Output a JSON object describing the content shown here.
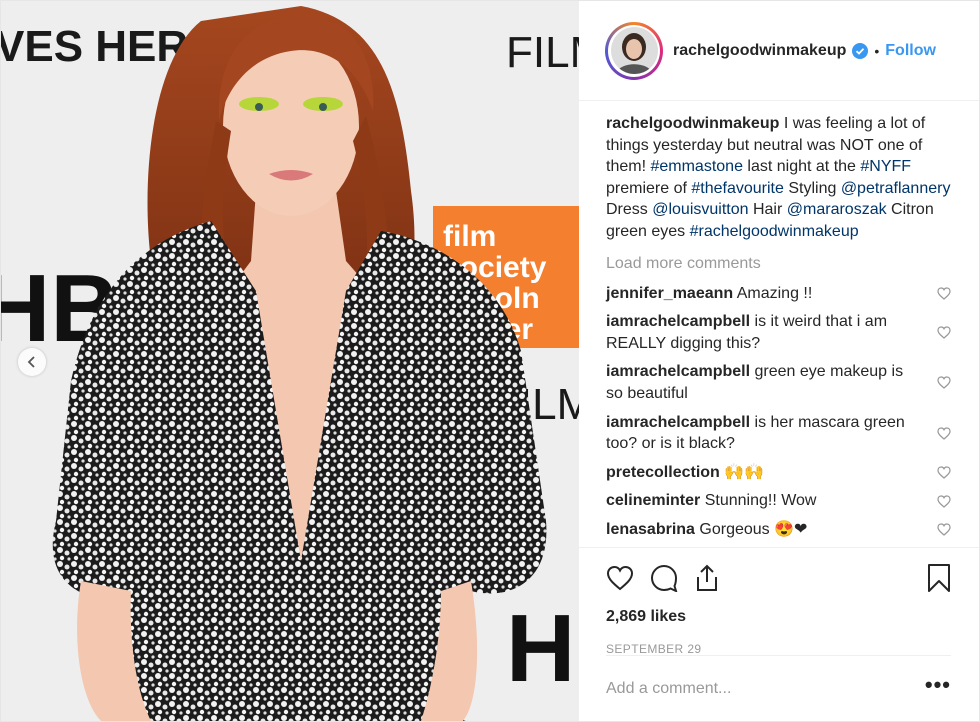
{
  "photo": {
    "alt_backdrop_text": [
      "VES HERE",
      "FILM",
      "film",
      "society",
      "lincoln",
      "center",
      "FILM",
      "HBO",
      "HI"
    ]
  },
  "header": {
    "username": "rachelgoodwinmakeup",
    "separator": "•",
    "follow_label": "Follow"
  },
  "caption": {
    "username": "rachelgoodwinmakeup",
    "parts": [
      " I was feeling a lot of things yesterday but neutral was NOT one of them! ",
      "#emmastone",
      " last night at the ",
      "#NYFF",
      " premiere of ",
      "#thefavourite",
      " Styling ",
      "@petraflannery",
      " Dress ",
      "@louisvuitton",
      " Hair ",
      "@mararoszak",
      " Citron green eyes ",
      "#rachelgoodwinmakeup"
    ]
  },
  "load_more": "Load more comments",
  "comments": [
    {
      "user": "jennifer_maeann",
      "text": "Amazing !!"
    },
    {
      "user": "iamrachelcampbell",
      "text": "is it weird that i am REALLY digging this?"
    },
    {
      "user": "iamrachelcampbell",
      "text": "green eye makeup is so beautiful"
    },
    {
      "user": "iamrachelcampbell",
      "text": "is her mascara green too? or is it black?"
    },
    {
      "user": "pretecollection",
      "text": "🙌🙌"
    },
    {
      "user": "celineminter",
      "text": "Stunning!! Wow"
    },
    {
      "user": "lenasabrina",
      "text": "Gorgeous 😍❤"
    }
  ],
  "likes": "2,869 likes",
  "date": "SEPTEMBER 29",
  "add_comment_placeholder": "Add a comment...",
  "more_options": "•••",
  "colors": {
    "link": "#003569",
    "follow": "#3897f0",
    "muted": "#999999"
  }
}
